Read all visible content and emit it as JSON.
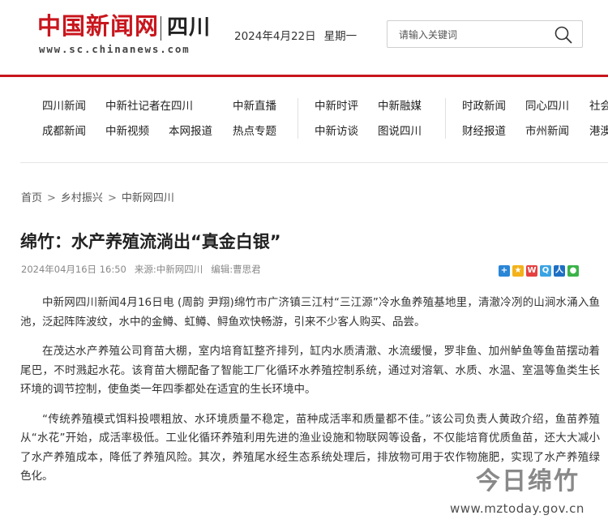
{
  "header": {
    "logo_text": "中国新闻网",
    "region": "四川",
    "url": "www.sc.chinanews.com",
    "date": "2024年4月22日",
    "weekday": "星期一",
    "search_placeholder": "请输入关键词",
    "accent": "#c8161d"
  },
  "nav": {
    "row1": [
      "四川新闻",
      "中新社记者在四川",
      "中新直播",
      "中新时评",
      "中新融媒",
      "时政新闻",
      "同心四川",
      "社会"
    ],
    "row2": [
      "成都新闻",
      "中新视频",
      "本网报道",
      "热点专题",
      "中新访谈",
      "图说四川",
      "财经报道",
      "市州新闻",
      "港澳"
    ]
  },
  "breadcrumb": [
    "首页",
    "乡村振兴",
    "中新网四川"
  ],
  "breadcrumb_sep": ">",
  "article": {
    "title": "绵竹：水产养殖流淌出“真金白银”",
    "datetime": "2024年04月16日 16:50",
    "source": "来源:中新网四川",
    "editor": "编辑:曹思君",
    "share_icons": [
      "add-icon",
      "qzone-icon",
      "weibo-icon",
      "qq-icon",
      "renren-icon",
      "wechat-icon"
    ],
    "paragraphs": [
      "中新网四川新闻4月16日电 (周韵 尹翔)绵竹市广济镇三江村“三江源”冷水鱼养殖基地里，清澈冷冽的山涧水涌入鱼池，泛起阵阵波纹，水中的金鳟、虹鳟、鲟鱼欢快畅游，引来不少客人购买、品尝。",
      "在茂达水产养殖公司育苗大棚，室内培育缸整齐排列，缸内水质清澈、水流缓慢，罗非鱼、加州鲈鱼等鱼苗摆动着尾巴，不时溅起水花。该育苗大棚配备了智能工厂化循环水养殖控制系统，通过对溶氧、水质、水温、室温等鱼类生长环境的调节控制，使鱼类一年四季都处在适宜的生长环境中。",
      "“传统养殖模式饵料投喂粗放、水环境质量不稳定，苗种成活率和质量都不佳。”该公司负责人黄政介绍，鱼苗养殖从“水花”开始，成活率极低。工业化循环养殖利用先进的渔业设施和物联网等设备，不仅能培育优质鱼苗，还大大减小了水产养殖成本，降低了养殖风险。其次，养殖尾水经生态系统处理后，排放物可用于农作物施肥，实现了水产养殖绿色化。"
    ]
  },
  "watermark": {
    "mark_text": "今日绵竹",
    "url": "www.mztoday.gov.cn"
  }
}
